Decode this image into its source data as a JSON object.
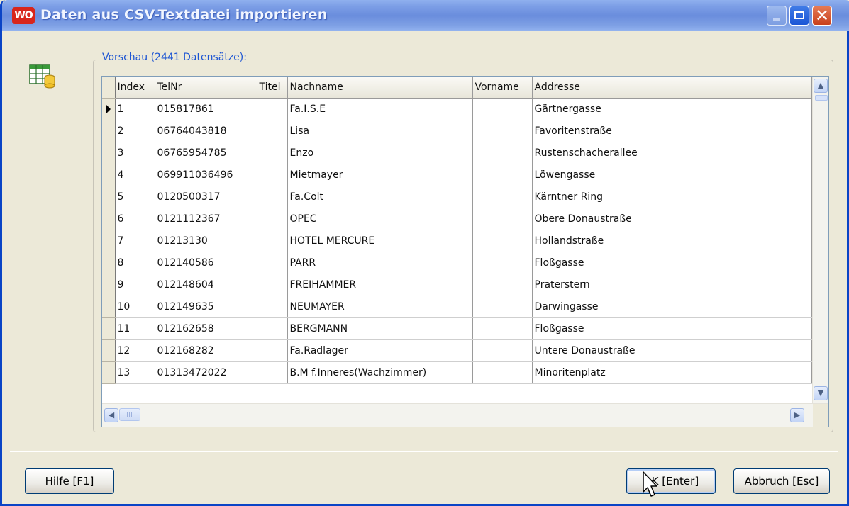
{
  "window": {
    "logo_text": "WO",
    "title": "Daten aus CSV-Textdatei importieren"
  },
  "titlebar_buttons": [
    "minimize",
    "maximize",
    "close"
  ],
  "icons": {
    "dialog_icon": "table-database-icon",
    "row_pointer": "triangle-right-icon",
    "mouse_cursor": "arrow-cursor-icon"
  },
  "preview": {
    "group_label": "Vorschau (2441 Datensätze):",
    "columns": [
      "Index",
      "TelNr",
      "Titel",
      "Nachname",
      "Vorname",
      "Addresse"
    ],
    "rows": [
      [
        "1",
        "015817861",
        "",
        "Fa.I.S.E",
        "",
        "Gärtnergasse"
      ],
      [
        "2",
        "06764043818",
        "",
        "Lisa",
        "",
        "Favoritenstraße"
      ],
      [
        "3",
        "06765954785",
        "",
        "Enzo",
        "",
        "Rustenschacherallee"
      ],
      [
        "4",
        "069911036496",
        "",
        "Mietmayer",
        "",
        "Löwengasse"
      ],
      [
        "5",
        "0120500317",
        "",
        "Fa.Colt",
        "",
        "Kärntner Ring"
      ],
      [
        "6",
        "0121112367",
        "",
        "OPEC",
        "",
        "Obere Donaustraße"
      ],
      [
        "7",
        "01213130",
        "",
        "HOTEL MERCURE",
        "",
        "Hollandstraße"
      ],
      [
        "8",
        "012140586",
        "",
        "PARR",
        "",
        "Floßgasse"
      ],
      [
        "9",
        "012148604",
        "",
        "FREIHAMMER",
        "",
        "Praterstern"
      ],
      [
        "10",
        "012149635",
        "",
        "NEUMAYER",
        "",
        "Darwingasse"
      ],
      [
        "11",
        "012162658",
        "",
        "BERGMANN",
        "",
        "Floßgasse"
      ],
      [
        "12",
        "012168282",
        "",
        "Fa.Radlager",
        "",
        "Untere Donaustraße"
      ],
      [
        "13",
        "01313472022",
        "",
        "B.M f.Inneres(Wachzimmer)",
        "",
        "Minoritenplatz"
      ]
    ],
    "selected_row": 0
  },
  "buttons": {
    "help": "Hilfe [F1]",
    "ok": "OK [Enter]",
    "cancel": "Abbruch [Esc]"
  }
}
